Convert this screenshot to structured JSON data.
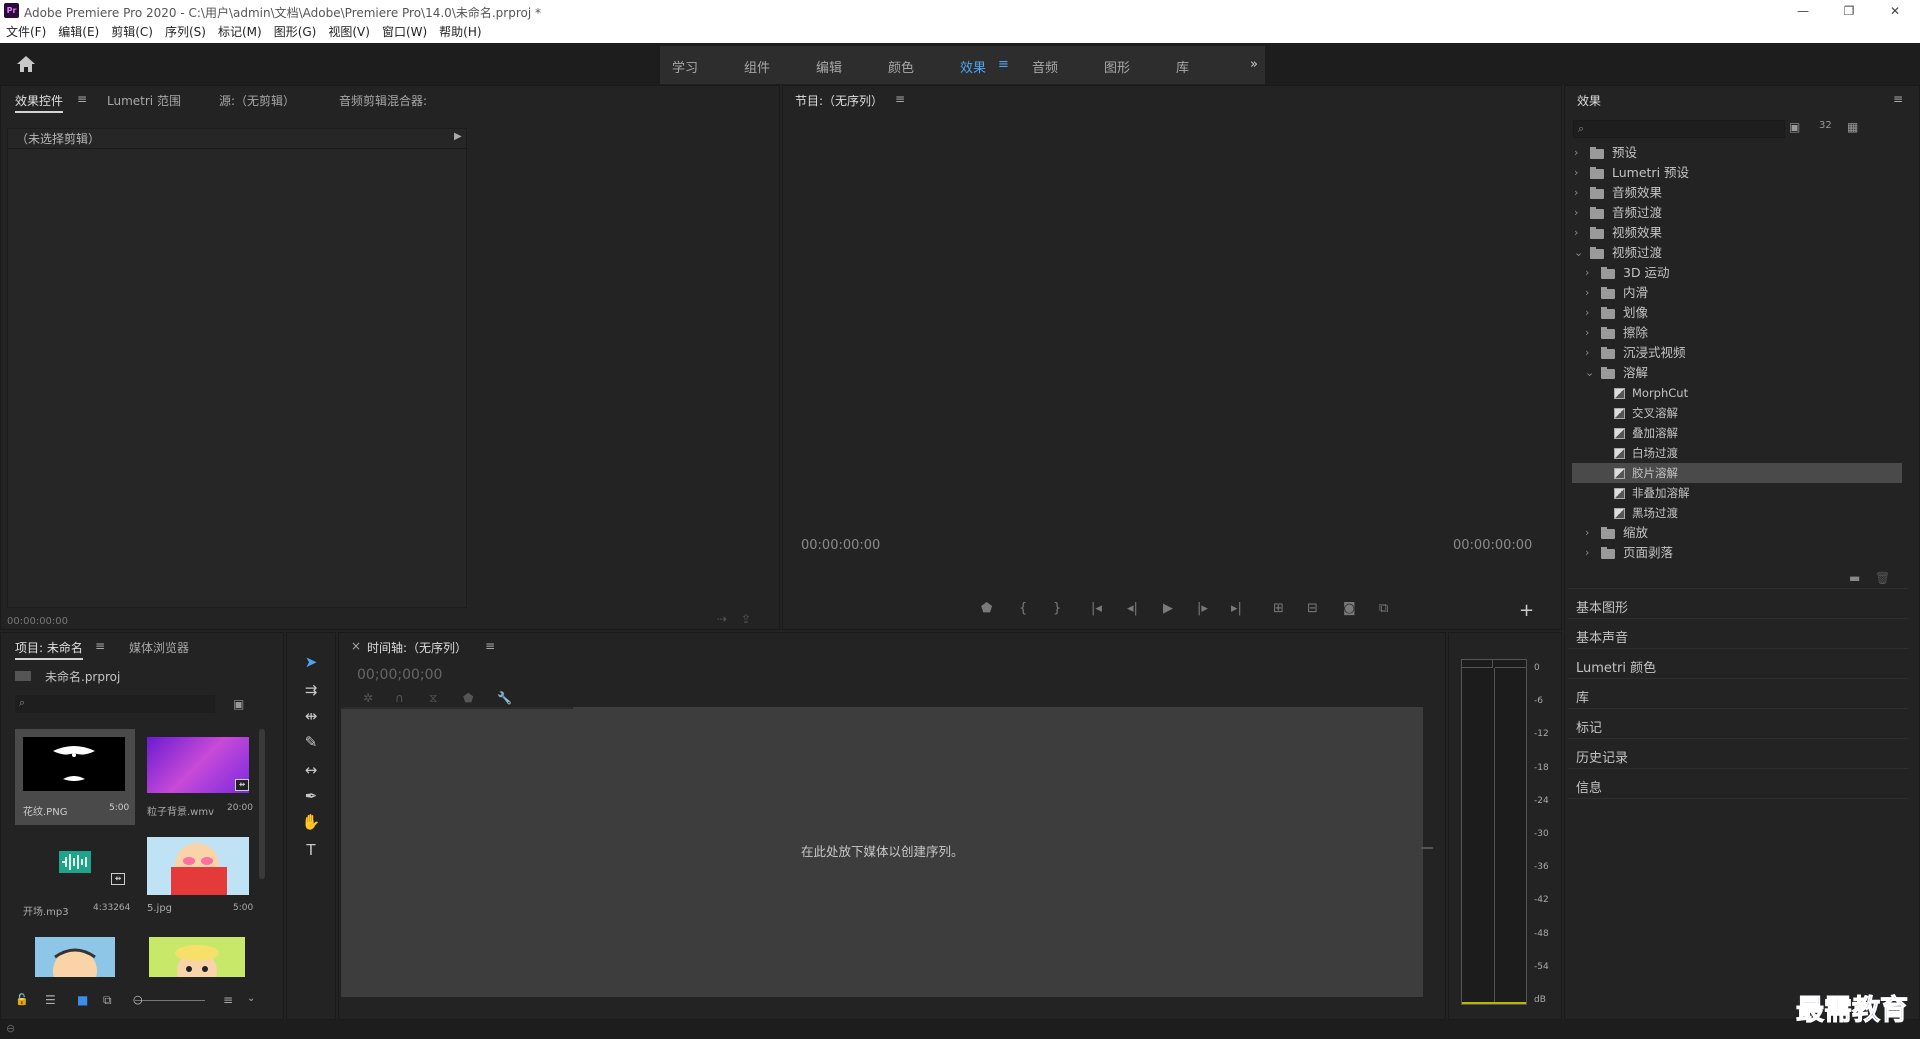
{
  "titlebar": {
    "app_icon": "Pr",
    "title": "Adobe Premiere Pro 2020 - C:\\用户\\admin\\文档\\Adobe\\Premiere Pro\\14.0\\未命名.prproj *",
    "minimize_icon": "minimize-icon",
    "restore_icon": "restore-icon",
    "close_icon": "close-icon"
  },
  "menubar": [
    "文件(F)",
    "编辑(E)",
    "剪辑(C)",
    "序列(S)",
    "标记(M)",
    "图形(G)",
    "视图(V)",
    "窗口(W)",
    "帮助(H)"
  ],
  "workspaces": {
    "items": [
      "学习",
      "组件",
      "编辑",
      "颜色",
      "效果",
      "音频",
      "图形",
      "库"
    ],
    "active": "效果",
    "overflow": "»"
  },
  "source_panel": {
    "tabs": [
      "效果控件",
      "Lumetri 范围",
      "源:（无剪辑）",
      "音频剪辑混合器:"
    ],
    "no_clip": "（未选择剪辑）",
    "timecode": "00:00:00:00"
  },
  "program_panel": {
    "title": "节目:（无序列）",
    "timecode_left": "00:00:00:00",
    "timecode_right": "00:00:00:00",
    "add_button": "+"
  },
  "effects_panel": {
    "title": "效果",
    "tree": [
      {
        "label": "预设",
        "level": 0,
        "expanded": false,
        "kind": "folder-special"
      },
      {
        "label": "Lumetri 预设",
        "level": 0,
        "expanded": false,
        "kind": "folder-special"
      },
      {
        "label": "音频效果",
        "level": 0,
        "expanded": false,
        "kind": "folder"
      },
      {
        "label": "音频过渡",
        "level": 0,
        "expanded": false,
        "kind": "folder"
      },
      {
        "label": "视频效果",
        "level": 0,
        "expanded": false,
        "kind": "folder"
      },
      {
        "label": "视频过渡",
        "level": 0,
        "expanded": true,
        "kind": "folder"
      },
      {
        "label": "3D 运动",
        "level": 1,
        "expanded": false,
        "kind": "folder"
      },
      {
        "label": "内滑",
        "level": 1,
        "expanded": false,
        "kind": "folder"
      },
      {
        "label": "划像",
        "level": 1,
        "expanded": false,
        "kind": "folder"
      },
      {
        "label": "擦除",
        "level": 1,
        "expanded": false,
        "kind": "folder"
      },
      {
        "label": "沉浸式视频",
        "level": 1,
        "expanded": false,
        "kind": "folder"
      },
      {
        "label": "溶解",
        "level": 1,
        "expanded": true,
        "kind": "folder"
      },
      {
        "label": "MorphCut",
        "level": 2,
        "kind": "effect"
      },
      {
        "label": "交叉溶解",
        "level": 2,
        "kind": "effect"
      },
      {
        "label": "叠加溶解",
        "level": 2,
        "kind": "effect"
      },
      {
        "label": "白场过渡",
        "level": 2,
        "kind": "effect"
      },
      {
        "label": "胶片溶解",
        "level": 2,
        "kind": "effect",
        "selected": true
      },
      {
        "label": "非叠加溶解",
        "level": 2,
        "kind": "effect"
      },
      {
        "label": "黑场过渡",
        "level": 2,
        "kind": "effect"
      },
      {
        "label": "缩放",
        "level": 1,
        "expanded": false,
        "kind": "folder"
      },
      {
        "label": "页面剥落",
        "level": 1,
        "expanded": false,
        "kind": "folder"
      }
    ],
    "side_panels": [
      "基本图形",
      "基本声音",
      "Lumetri 颜色",
      "库",
      "标记",
      "历史记录",
      "信息"
    ]
  },
  "project_panel": {
    "tabs": [
      "项目: 未命名",
      "媒体浏览器"
    ],
    "project_file": "未命名.prproj",
    "items": [
      {
        "name": "花纹.PNG",
        "duration": "5:00"
      },
      {
        "name": "粒子背景.wmv",
        "duration": "20:00"
      },
      {
        "name": "开场.mp3",
        "duration": "4:33264"
      },
      {
        "name": "5.jpg",
        "duration": "5:00"
      }
    ]
  },
  "timeline_panel": {
    "title": "时间轴:（无序列）",
    "timecode": "00;00;00;00",
    "empty_message": "在此处放下媒体以创建序列。"
  },
  "audio_meter": {
    "labels": [
      "0",
      "-6",
      "-12",
      "-18",
      "-24",
      "-30",
      "-36",
      "-42",
      "-48",
      "-54",
      "dB"
    ]
  },
  "watermark": "最需教育",
  "colors": {
    "accent": "#4ea3f0",
    "panel_bg": "#232323",
    "frame_bg": "#1d1d1d"
  }
}
